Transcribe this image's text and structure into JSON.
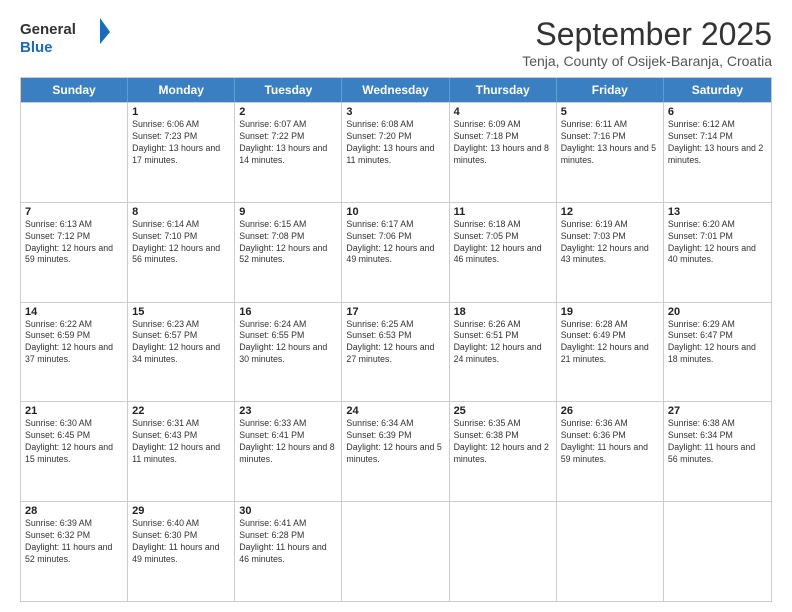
{
  "logo": {
    "general": "General",
    "blue": "Blue"
  },
  "title": "September 2025",
  "location": "Tenja, County of Osijek-Baranja, Croatia",
  "days": [
    "Sunday",
    "Monday",
    "Tuesday",
    "Wednesday",
    "Thursday",
    "Friday",
    "Saturday"
  ],
  "weeks": [
    [
      {
        "day": "",
        "sunrise": "",
        "sunset": "",
        "daylight": ""
      },
      {
        "day": "1",
        "sunrise": "Sunrise: 6:06 AM",
        "sunset": "Sunset: 7:23 PM",
        "daylight": "Daylight: 13 hours and 17 minutes."
      },
      {
        "day": "2",
        "sunrise": "Sunrise: 6:07 AM",
        "sunset": "Sunset: 7:22 PM",
        "daylight": "Daylight: 13 hours and 14 minutes."
      },
      {
        "day": "3",
        "sunrise": "Sunrise: 6:08 AM",
        "sunset": "Sunset: 7:20 PM",
        "daylight": "Daylight: 13 hours and 11 minutes."
      },
      {
        "day": "4",
        "sunrise": "Sunrise: 6:09 AM",
        "sunset": "Sunset: 7:18 PM",
        "daylight": "Daylight: 13 hours and 8 minutes."
      },
      {
        "day": "5",
        "sunrise": "Sunrise: 6:11 AM",
        "sunset": "Sunset: 7:16 PM",
        "daylight": "Daylight: 13 hours and 5 minutes."
      },
      {
        "day": "6",
        "sunrise": "Sunrise: 6:12 AM",
        "sunset": "Sunset: 7:14 PM",
        "daylight": "Daylight: 13 hours and 2 minutes."
      }
    ],
    [
      {
        "day": "7",
        "sunrise": "Sunrise: 6:13 AM",
        "sunset": "Sunset: 7:12 PM",
        "daylight": "Daylight: 12 hours and 59 minutes."
      },
      {
        "day": "8",
        "sunrise": "Sunrise: 6:14 AM",
        "sunset": "Sunset: 7:10 PM",
        "daylight": "Daylight: 12 hours and 56 minutes."
      },
      {
        "day": "9",
        "sunrise": "Sunrise: 6:15 AM",
        "sunset": "Sunset: 7:08 PM",
        "daylight": "Daylight: 12 hours and 52 minutes."
      },
      {
        "day": "10",
        "sunrise": "Sunrise: 6:17 AM",
        "sunset": "Sunset: 7:06 PM",
        "daylight": "Daylight: 12 hours and 49 minutes."
      },
      {
        "day": "11",
        "sunrise": "Sunrise: 6:18 AM",
        "sunset": "Sunset: 7:05 PM",
        "daylight": "Daylight: 12 hours and 46 minutes."
      },
      {
        "day": "12",
        "sunrise": "Sunrise: 6:19 AM",
        "sunset": "Sunset: 7:03 PM",
        "daylight": "Daylight: 12 hours and 43 minutes."
      },
      {
        "day": "13",
        "sunrise": "Sunrise: 6:20 AM",
        "sunset": "Sunset: 7:01 PM",
        "daylight": "Daylight: 12 hours and 40 minutes."
      }
    ],
    [
      {
        "day": "14",
        "sunrise": "Sunrise: 6:22 AM",
        "sunset": "Sunset: 6:59 PM",
        "daylight": "Daylight: 12 hours and 37 minutes."
      },
      {
        "day": "15",
        "sunrise": "Sunrise: 6:23 AM",
        "sunset": "Sunset: 6:57 PM",
        "daylight": "Daylight: 12 hours and 34 minutes."
      },
      {
        "day": "16",
        "sunrise": "Sunrise: 6:24 AM",
        "sunset": "Sunset: 6:55 PM",
        "daylight": "Daylight: 12 hours and 30 minutes."
      },
      {
        "day": "17",
        "sunrise": "Sunrise: 6:25 AM",
        "sunset": "Sunset: 6:53 PM",
        "daylight": "Daylight: 12 hours and 27 minutes."
      },
      {
        "day": "18",
        "sunrise": "Sunrise: 6:26 AM",
        "sunset": "Sunset: 6:51 PM",
        "daylight": "Daylight: 12 hours and 24 minutes."
      },
      {
        "day": "19",
        "sunrise": "Sunrise: 6:28 AM",
        "sunset": "Sunset: 6:49 PM",
        "daylight": "Daylight: 12 hours and 21 minutes."
      },
      {
        "day": "20",
        "sunrise": "Sunrise: 6:29 AM",
        "sunset": "Sunset: 6:47 PM",
        "daylight": "Daylight: 12 hours and 18 minutes."
      }
    ],
    [
      {
        "day": "21",
        "sunrise": "Sunrise: 6:30 AM",
        "sunset": "Sunset: 6:45 PM",
        "daylight": "Daylight: 12 hours and 15 minutes."
      },
      {
        "day": "22",
        "sunrise": "Sunrise: 6:31 AM",
        "sunset": "Sunset: 6:43 PM",
        "daylight": "Daylight: 12 hours and 11 minutes."
      },
      {
        "day": "23",
        "sunrise": "Sunrise: 6:33 AM",
        "sunset": "Sunset: 6:41 PM",
        "daylight": "Daylight: 12 hours and 8 minutes."
      },
      {
        "day": "24",
        "sunrise": "Sunrise: 6:34 AM",
        "sunset": "Sunset: 6:39 PM",
        "daylight": "Daylight: 12 hours and 5 minutes."
      },
      {
        "day": "25",
        "sunrise": "Sunrise: 6:35 AM",
        "sunset": "Sunset: 6:38 PM",
        "daylight": "Daylight: 12 hours and 2 minutes."
      },
      {
        "day": "26",
        "sunrise": "Sunrise: 6:36 AM",
        "sunset": "Sunset: 6:36 PM",
        "daylight": "Daylight: 11 hours and 59 minutes."
      },
      {
        "day": "27",
        "sunrise": "Sunrise: 6:38 AM",
        "sunset": "Sunset: 6:34 PM",
        "daylight": "Daylight: 11 hours and 56 minutes."
      }
    ],
    [
      {
        "day": "28",
        "sunrise": "Sunrise: 6:39 AM",
        "sunset": "Sunset: 6:32 PM",
        "daylight": "Daylight: 11 hours and 52 minutes."
      },
      {
        "day": "29",
        "sunrise": "Sunrise: 6:40 AM",
        "sunset": "Sunset: 6:30 PM",
        "daylight": "Daylight: 11 hours and 49 minutes."
      },
      {
        "day": "30",
        "sunrise": "Sunrise: 6:41 AM",
        "sunset": "Sunset: 6:28 PM",
        "daylight": "Daylight: 11 hours and 46 minutes."
      },
      {
        "day": "",
        "sunrise": "",
        "sunset": "",
        "daylight": ""
      },
      {
        "day": "",
        "sunrise": "",
        "sunset": "",
        "daylight": ""
      },
      {
        "day": "",
        "sunrise": "",
        "sunset": "",
        "daylight": ""
      },
      {
        "day": "",
        "sunrise": "",
        "sunset": "",
        "daylight": ""
      }
    ]
  ]
}
